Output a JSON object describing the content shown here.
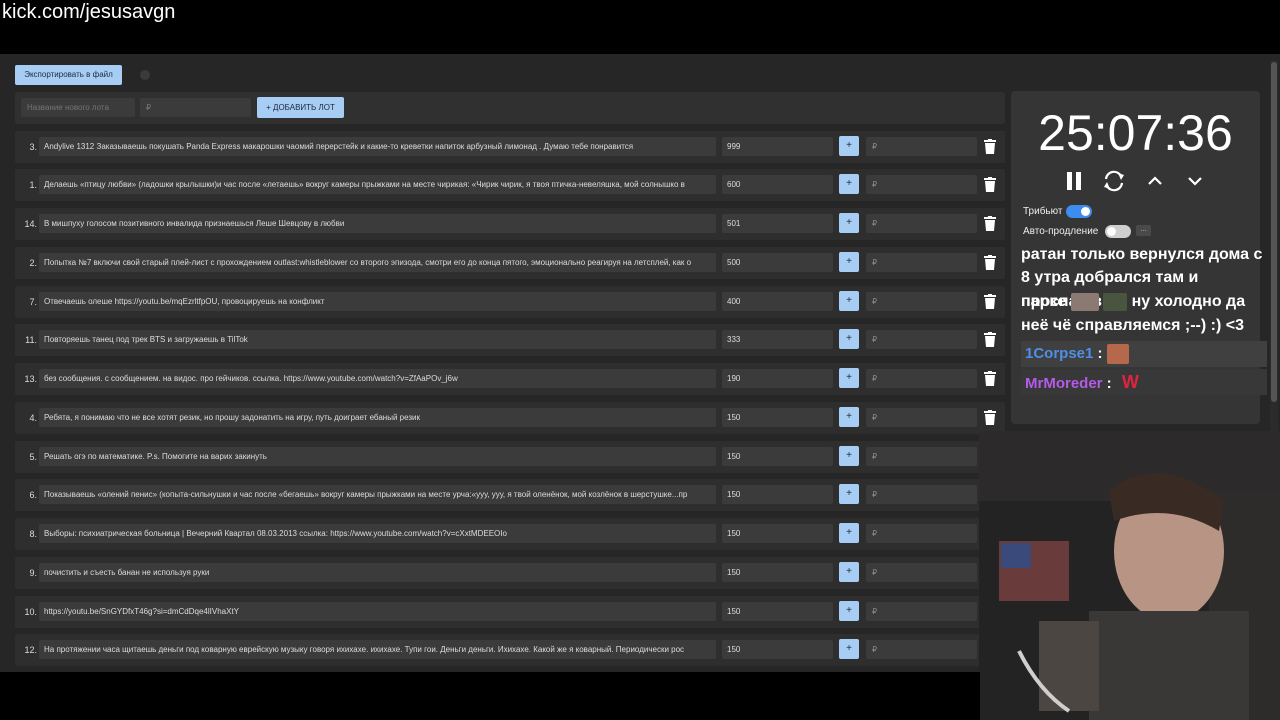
{
  "channel_url": "kick.com/jesusavgn",
  "export_button": "Экспортировать в файл",
  "new_lot": {
    "name_placeholder": "Название нового лота",
    "amount_placeholder": "₽",
    "add_button": "+ ДОБАВИТЬ ЛОТ"
  },
  "lots": [
    {
      "num": "3.",
      "text": "Andylive 1312 Заказываешь покушать Panda Express макарошки чаомий перерстейк и какие-то креветки напиток арбузный лимонад . Думаю тебе понравится",
      "amount": "999",
      "plus": "+",
      "add_placeholder": "₽"
    },
    {
      "num": "1.",
      "text": "Делаешь «птицу любви» (ладошки крылышки)и час после «летаешь» вокруг камеры прыжками на месте чирикая: «Чирик чирик, я твоя птичка-невеляшка, мой солнышко в",
      "amount": "600",
      "plus": "+",
      "add_placeholder": "₽"
    },
    {
      "num": "14.",
      "text": "В мишпуху голосом позитивного инвалида признаешься Леше Шевцову в любви",
      "amount": "501",
      "plus": "+",
      "add_placeholder": "₽"
    },
    {
      "num": "2.",
      "text": "Попытка №7 включи свой старый плей-лист с прохождением outlast:whistleblower со второго эпизода, смотри его до конца пятого, эмоционально реагируя на летсплей, как о",
      "amount": "500",
      "plus": "+",
      "add_placeholder": "₽"
    },
    {
      "num": "7.",
      "text": "Отвечаешь олеше https://youtu.be/mqEzrltfpOU, провоцируешь на конфликт",
      "amount": "400",
      "plus": "+",
      "add_placeholder": "₽"
    },
    {
      "num": "11.",
      "text": "Повторяешь танец под трек BTS и загружаешь в TilTok",
      "amount": "333",
      "plus": "+",
      "add_placeholder": "₽"
    },
    {
      "num": "13.",
      "text": "без сообщения. с сообщением. на видос. про гейчиков. ссылка. https://www.youtube.com/watch?v=ZfAaPOv_j6w",
      "amount": "190",
      "plus": "+",
      "add_placeholder": "₽"
    },
    {
      "num": "4.",
      "text": "Ребята, я понимаю что не все хотят резик, но прошу задонатить на игру, путь доиграет ебаный резик",
      "amount": "150",
      "plus": "+",
      "add_placeholder": "₽"
    },
    {
      "num": "5.",
      "text": "Решать огэ по математике. P.s. Помогите на варих закинуть",
      "amount": "150",
      "plus": "+",
      "add_placeholder": "₽"
    },
    {
      "num": "6.",
      "text": "Показываешь «олений пенис» (копыта-сильнушки и час после «бегаешь» вокруг камеры прыжками на месте урча:«ууу, ууу, я твой оленёнок, мой козлёнок в шерстушке...пр",
      "amount": "150",
      "plus": "+",
      "add_placeholder": "₽"
    },
    {
      "num": "8.",
      "text": "Выборы: психиатрическая больница | Вечерний Квартал 08.03.2013 ссылка: https://www.youtube.com/watch?v=cXxtMDEEOIo",
      "amount": "150",
      "plus": "+",
      "add_placeholder": "₽"
    },
    {
      "num": "9.",
      "text": "почистить и съесть банан не используя руки",
      "amount": "150",
      "plus": "+",
      "add_placeholder": "₽"
    },
    {
      "num": "10.",
      "text": "https://youtu.be/SnGYDfxT46g?si=dmCdDqe4lIVhaXtY",
      "amount": "150",
      "plus": "+",
      "add_placeholder": "₽"
    },
    {
      "num": "12.",
      "text": "На протяжении часа щитаешь деньги под коварную еврейскую музыку говоря ихихахе. ихихахе. Тупи гои. Деньги деньги. Ихихахе. Какой же я коварный. Периодически рос",
      "amount": "150",
      "plus": "+",
      "add_placeholder": "₽"
    }
  ],
  "timer": {
    "time": "25:07:36",
    "tribute_label": "Трибьют",
    "tribute_on": true,
    "auto_extend_label": "Авто-продление",
    "auto_extend_on": false,
    "more_label": "..."
  },
  "chat": {
    "message_lines": [
      "ратан только вернулся дома с",
      "8 утра добрался там и проспал в",
      "парке",
      "ну холодно да",
      "неё чё справляемся ;--) :) <3"
    ],
    "users": [
      {
        "name": "1Corpse1",
        "sep": " :",
        "color": "#4d8fe6"
      },
      {
        "name": "MrMoreder",
        "sep": " :",
        "color": "#b35ce8"
      }
    ],
    "emote_text": "W"
  },
  "colors": {
    "accent": "#a8cdf5",
    "panel": "#353535",
    "toggle_on": "#3d8cf0"
  }
}
